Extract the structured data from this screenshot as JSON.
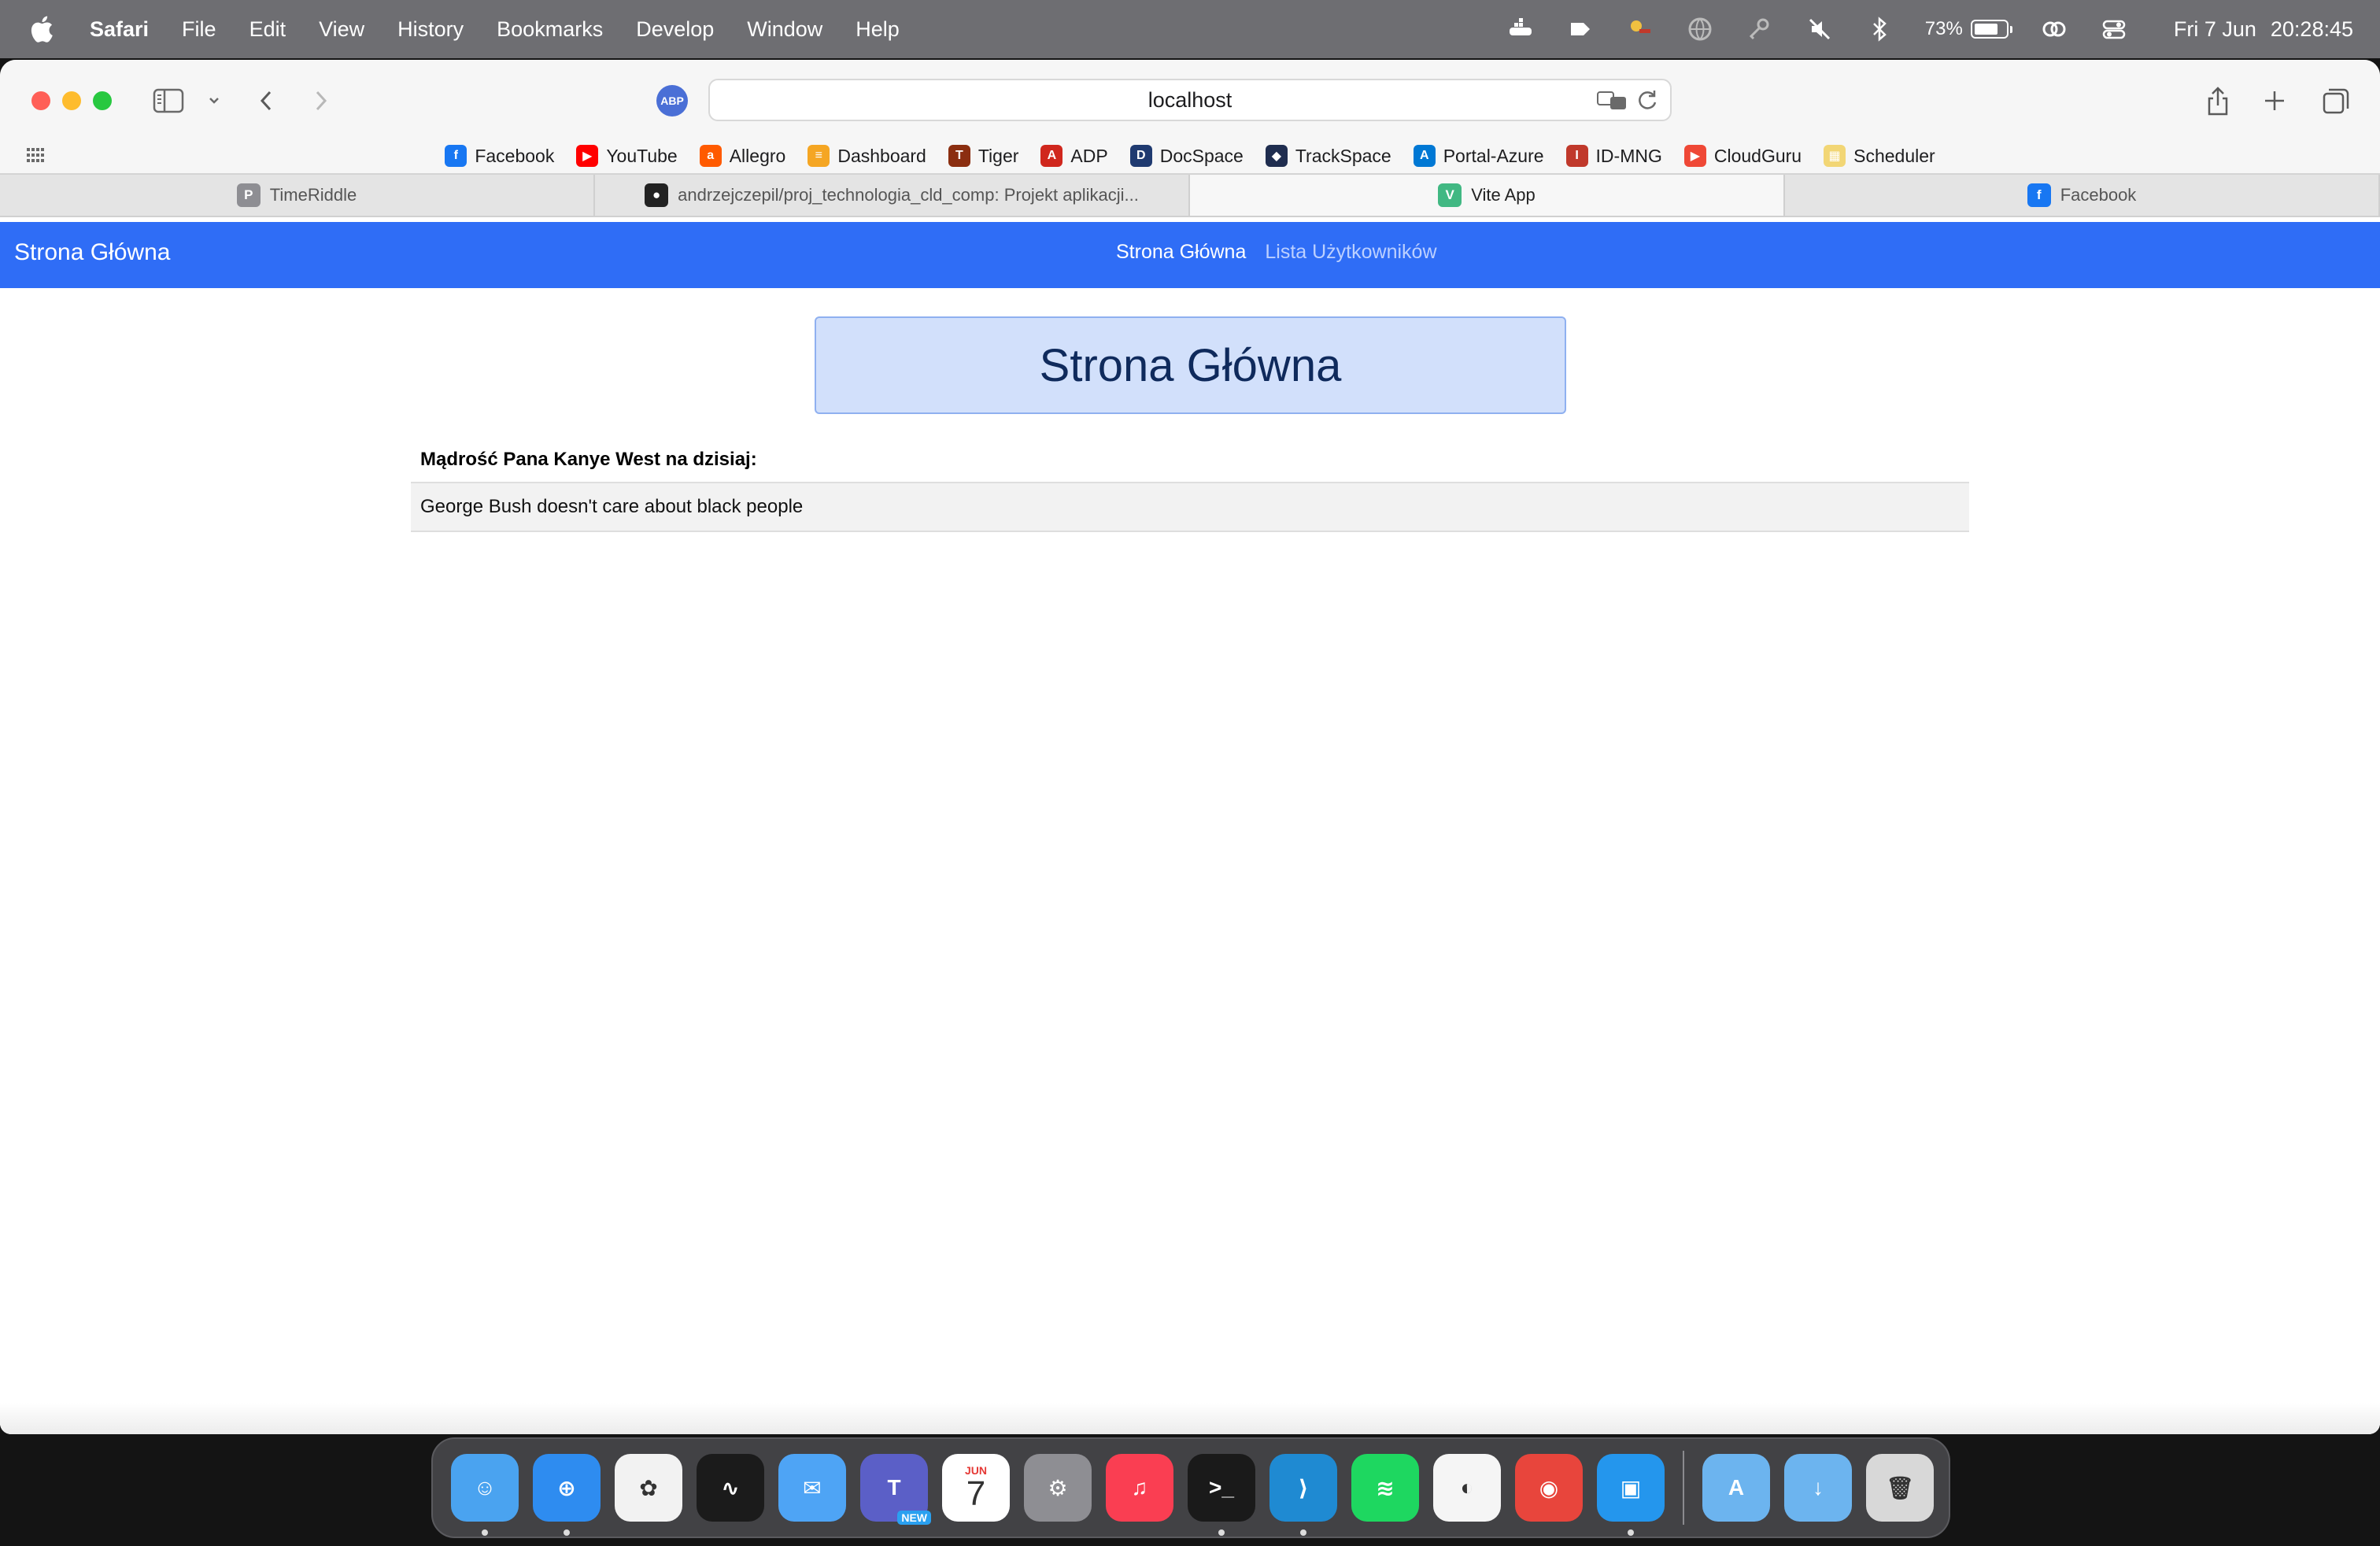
{
  "menubar": {
    "app": "Safari",
    "items": [
      "File",
      "Edit",
      "View",
      "History",
      "Bookmarks",
      "Develop",
      "Window",
      "Help"
    ],
    "battery_percent": "73%",
    "battery_level": 0.73,
    "date": "Fri 7 Jun",
    "time": "20:28:45"
  },
  "toolbar": {
    "url": "localhost",
    "abp_label": "ABP"
  },
  "favorites": [
    {
      "label": "Facebook",
      "icon": "facebook-icon",
      "color": "#1877f2",
      "glyph": "f"
    },
    {
      "label": "YouTube",
      "icon": "youtube-icon",
      "color": "#ff0000",
      "glyph": "▶"
    },
    {
      "label": "Allegro",
      "icon": "allegro-icon",
      "color": "#ff5a00",
      "glyph": "a"
    },
    {
      "label": "Dashboard",
      "icon": "dashboard-icon",
      "color": "#f5a623",
      "glyph": "≡"
    },
    {
      "label": "Tiger",
      "icon": "tiger-icon",
      "color": "#8b2e10",
      "glyph": "T"
    },
    {
      "label": "ADP",
      "icon": "adp-icon",
      "color": "#d0271d",
      "glyph": "A"
    },
    {
      "label": "DocSpace",
      "icon": "docspace-icon",
      "color": "#1f3a70",
      "glyph": "D"
    },
    {
      "label": "TrackSpace",
      "icon": "trackspace-icon",
      "color": "#1f2d4f",
      "glyph": "◆"
    },
    {
      "label": "Portal-Azure",
      "icon": "azure-icon",
      "color": "#0078d4",
      "glyph": "A"
    },
    {
      "label": "ID-MNG",
      "icon": "id-mng-icon",
      "color": "#c0392b",
      "glyph": "I"
    },
    {
      "label": "CloudGuru",
      "icon": "cloudguru-icon",
      "color": "#ef4836",
      "glyph": "▶"
    },
    {
      "label": "Scheduler",
      "icon": "scheduler-icon",
      "color": "#f2d675",
      "glyph": "▦"
    }
  ],
  "tabs": [
    {
      "label": "TimeRiddle",
      "icon": "timeriddle-icon",
      "color": "#8e8e93",
      "glyph": "P"
    },
    {
      "label": "andrzejczepil/proj_technologia_cld_comp: Projekt aplikacji...",
      "icon": "github-icon",
      "color": "#222222",
      "glyph": "●"
    },
    {
      "label": "Vite App",
      "icon": "vue-icon",
      "color": "#41b883",
      "glyph": "V"
    },
    {
      "label": "Facebook",
      "icon": "facebook-icon",
      "color": "#1877f2",
      "glyph": "f"
    }
  ],
  "active_tab_index": 2,
  "page": {
    "brand": "Strona Główna",
    "nav": [
      "Strona Główna",
      "Lista Użytkowników"
    ],
    "heading": "Strona Główna",
    "quote_label": "Mądrość Pana Kanye West na dzisiaj:",
    "quote": "George Bush doesn't care about black people"
  },
  "dock": [
    {
      "name": "finder-icon",
      "color": "#4aa3f0",
      "glyph": "☺",
      "running": true
    },
    {
      "name": "safari-icon",
      "color": "#2e8cf0",
      "glyph": "⊕",
      "running": true
    },
    {
      "name": "photos-icon",
      "color": "#f2f2f2",
      "glyph": "✿",
      "running": false
    },
    {
      "name": "activity-monitor-icon",
      "color": "#1b1b1b",
      "glyph": "∿",
      "running": false
    },
    {
      "name": "mail-icon",
      "color": "#4ea4f5",
      "glyph": "✉",
      "running": false
    },
    {
      "name": "teams-icon",
      "color": "#5b5fc7",
      "glyph": "T",
      "running": false,
      "badge": "NEW"
    },
    {
      "name": "calendar-icon",
      "color": "#ffffff",
      "glyph": "7",
      "running": false,
      "month": "JUN"
    },
    {
      "name": "system-settings-icon",
      "color": "#8e8e93",
      "glyph": "⚙",
      "running": false
    },
    {
      "name": "music-icon",
      "color": "#fa3e52",
      "glyph": "♫",
      "running": false
    },
    {
      "name": "terminal-icon",
      "color": "#1a1a1a",
      "glyph": ">_",
      "running": true
    },
    {
      "name": "vscode-icon",
      "color": "#1f8ad2",
      "glyph": "⟩",
      "running": true
    },
    {
      "name": "spotify-icon",
      "color": "#1ed760",
      "glyph": "≋",
      "running": false
    },
    {
      "name": "network-app-icon",
      "color": "#f5f5f5",
      "glyph": "◐",
      "running": false
    },
    {
      "name": "chrome-icon",
      "color": "#e8453c",
      "glyph": "◉",
      "running": false
    },
    {
      "name": "docker-icon",
      "color": "#2496ed",
      "glyph": "▣",
      "running": true
    }
  ],
  "dock_right": [
    {
      "name": "applications-folder-icon",
      "color": "#6cb4ef",
      "glyph": "A"
    },
    {
      "name": "downloads-folder-icon",
      "color": "#6cb4ef",
      "glyph": "↓"
    },
    {
      "name": "trash-icon",
      "color": "#d8d8d8",
      "glyph": "🗑"
    }
  ]
}
